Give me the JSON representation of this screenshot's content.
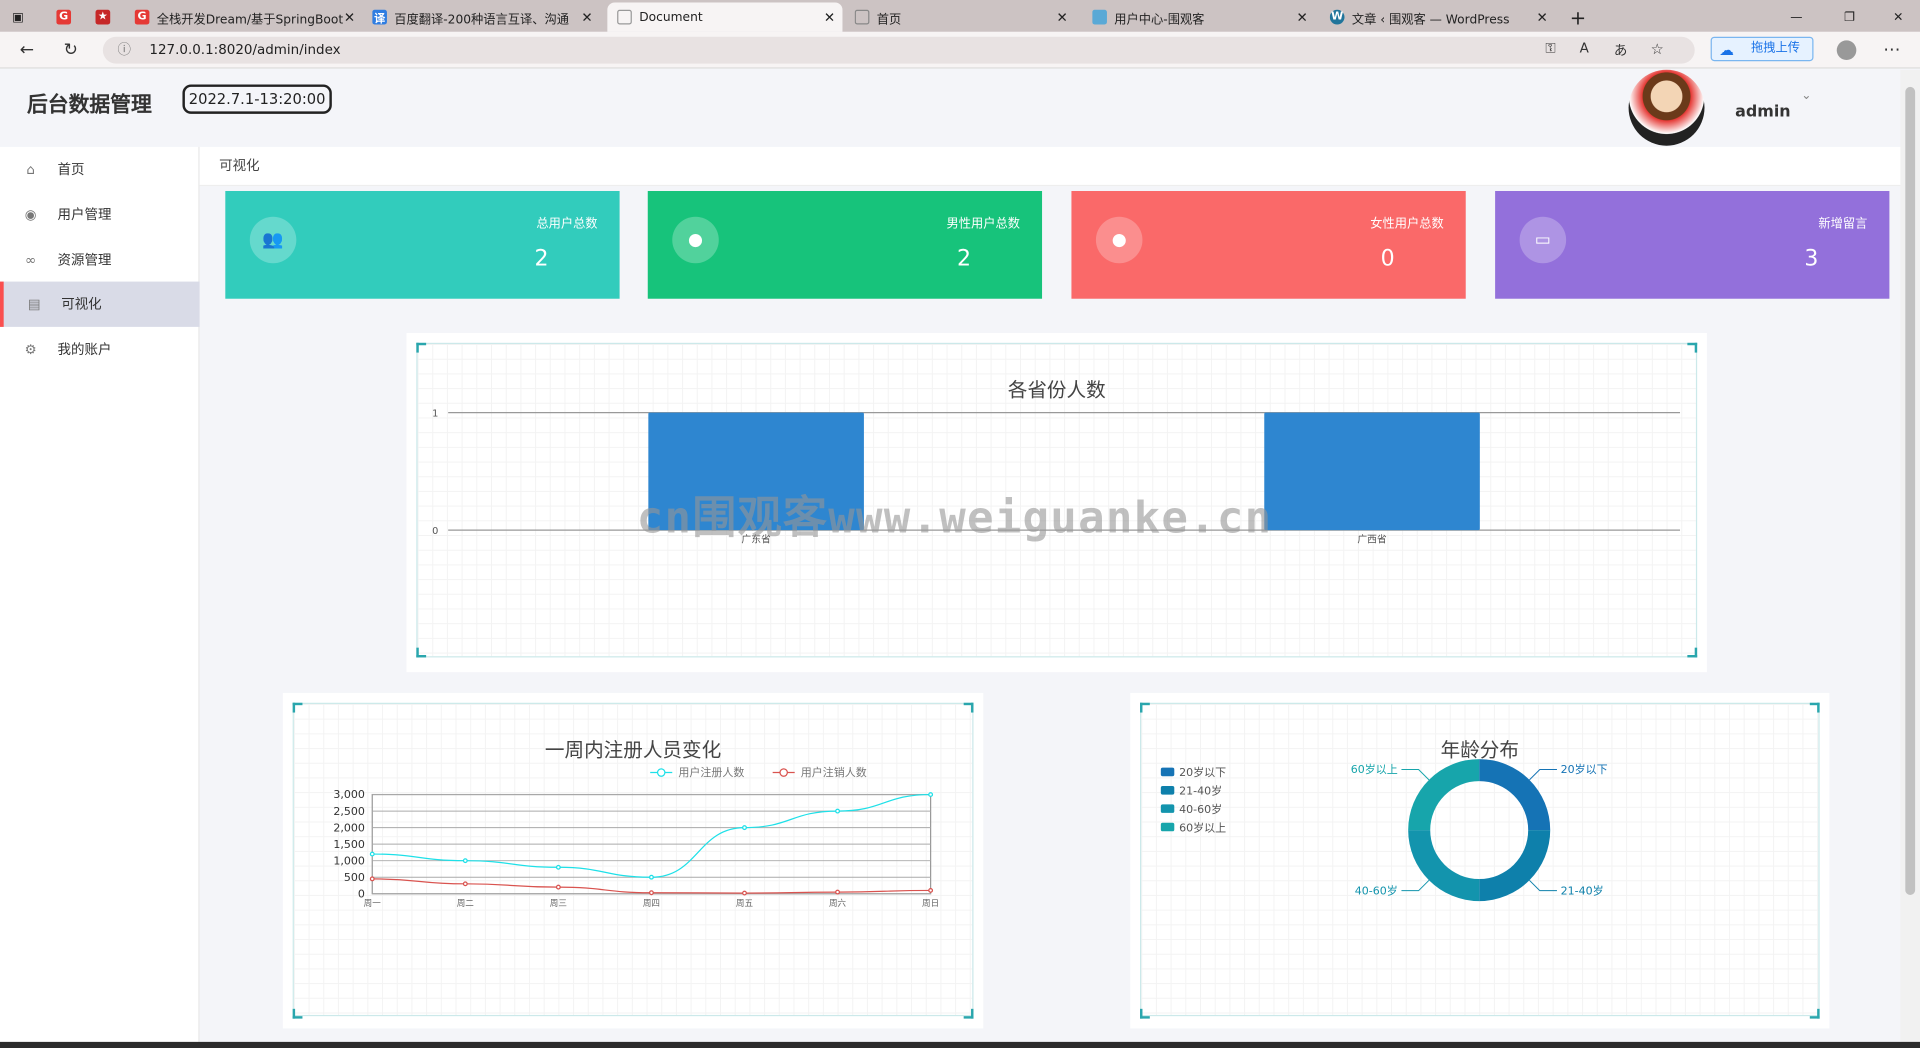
{
  "browser": {
    "tabs": [
      {
        "label": "全栈开发Dream/基于SpringBoot"
      },
      {
        "label": "百度翻译-200种语言互译、沟通"
      },
      {
        "label": "Document"
      },
      {
        "label": "首页"
      },
      {
        "label": "用户中心-围观客"
      },
      {
        "label": "文章 ‹ 围观客 — WordPress"
      }
    ],
    "url": "127.0.0.1:8020/admin/index",
    "upload_label": "拖拽上传"
  },
  "header": {
    "brand": "后台数据管理",
    "datetime": "2022.7.1-13:20:00",
    "username": "admin"
  },
  "sidebar": {
    "items": [
      {
        "label": "首页",
        "icon": "home-icon"
      },
      {
        "label": "用户管理",
        "icon": "user-circle-icon"
      },
      {
        "label": "资源管理",
        "icon": "link-icon"
      },
      {
        "label": "可视化",
        "icon": "clipboard-icon",
        "active": true
      },
      {
        "label": "我的账户",
        "icon": "gear-icon"
      }
    ]
  },
  "breadcrumb": "可视化",
  "stats": [
    {
      "label": "总用户总数",
      "value": "2",
      "color": "#32ccbc",
      "icon": "users-icon"
    },
    {
      "label": "男性用户总数",
      "value": "2",
      "color": "#17c37b",
      "icon": "user-icon"
    },
    {
      "label": "女性用户总数",
      "value": "0",
      "color": "#fa6969",
      "icon": "user-icon"
    },
    {
      "label": "新增留言",
      "value": "3",
      "color": "#9370db",
      "icon": "message-icon"
    }
  ],
  "watermark": "cn围观客www.weiguanke.cn",
  "chart_data": [
    {
      "type": "bar",
      "title": "各省份人数",
      "categories": [
        "广东省",
        "广西省"
      ],
      "values": [
        1,
        1
      ],
      "ylim": [
        0,
        1
      ],
      "yticks": [
        "0",
        "1"
      ],
      "color": "#2e86d0"
    },
    {
      "type": "line",
      "title": "一周内注册人员变化",
      "categories": [
        "周一",
        "周二",
        "周三",
        "周四",
        "周五",
        "周六",
        "周日"
      ],
      "ylim": [
        0,
        3000
      ],
      "yticks": [
        "0",
        "500",
        "1,000",
        "1,500",
        "2,000",
        "2,500",
        "3,000"
      ],
      "series": [
        {
          "name": "用户注册人数",
          "values": [
            1200,
            1000,
            800,
            500,
            2000,
            2500,
            3000
          ],
          "color": "#1ee0e8"
        },
        {
          "name": "用户注销人数",
          "values": [
            450,
            300,
            200,
            30,
            20,
            50,
            100
          ],
          "color": "#d9534f"
        }
      ]
    },
    {
      "type": "pie",
      "title": "年龄分布",
      "categories": [
        "20岁以下",
        "21-40岁",
        "40-60岁",
        "60岁以上"
      ],
      "values": [
        1,
        1,
        1,
        1
      ],
      "colors": [
        "#1573b5",
        "#0e80ab",
        "#1394ad",
        "#17a5ab"
      ],
      "legend": "left"
    }
  ]
}
